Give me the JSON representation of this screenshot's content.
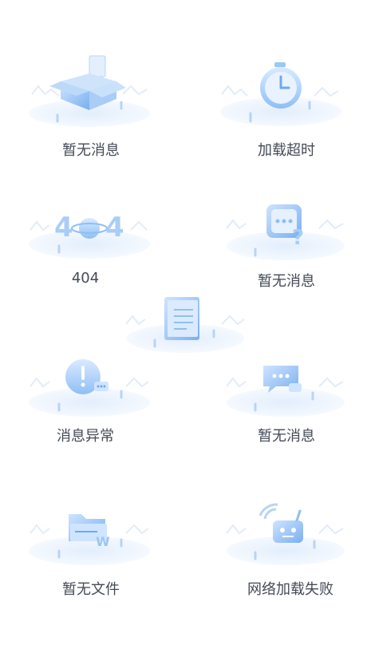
{
  "states": [
    {
      "id": "no-message-1",
      "label": "暂无消息",
      "icon": "open-box-icon"
    },
    {
      "id": "timeout",
      "label": "加载超时",
      "icon": "stopwatch-icon"
    },
    {
      "id": "not-found",
      "label": "404",
      "icon": "404-planet-icon"
    },
    {
      "id": "no-message-2",
      "label": "暂无消息",
      "icon": "chat-question-icon"
    },
    {
      "id": "document",
      "label": "",
      "icon": "document-icon"
    },
    {
      "id": "message-error",
      "label": "消息异常",
      "icon": "alert-bubble-icon"
    },
    {
      "id": "no-message-3",
      "label": "暂无消息",
      "icon": "chat-bubbles-icon"
    },
    {
      "id": "no-file",
      "label": "暂无文件",
      "icon": "folder-icon"
    },
    {
      "id": "network-fail",
      "label": "网络加载失败",
      "icon": "broken-signal-robot-icon"
    }
  ],
  "colors": {
    "accent": "#9cc6f5",
    "accent_dark": "#6fa8ee",
    "ground": "#e6f0fd",
    "label": "#444a55"
  }
}
